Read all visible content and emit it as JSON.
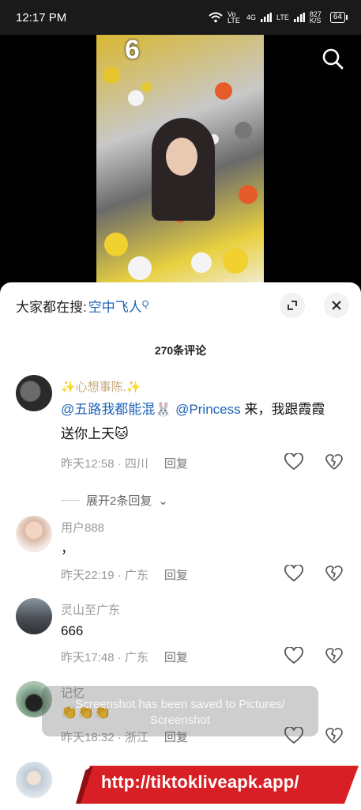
{
  "status": {
    "time": "12:17 PM",
    "net1": "Vo LTE",
    "net2": "4G",
    "net3": "LTE",
    "speed": "827 K/S",
    "battery": "64"
  },
  "video": {
    "number": "6"
  },
  "sheet": {
    "search_prefix": "大家都在搜:",
    "search_term": "空中飞人",
    "count_title": "270条评论"
  },
  "comments": [
    {
      "user": "✨心想事陈.✨",
      "mention1": "@五路我都能混",
      "mention2": "@Princess",
      "text_after": " 来，我跟霞霞送你上天",
      "time": "昨天12:58 · 四川",
      "reply": "回复",
      "expand": "展开2条回复"
    },
    {
      "user": "用户888",
      "text": "，",
      "time": "昨天22:19 · 广东",
      "reply": "回复"
    },
    {
      "user": "灵山至广东",
      "text": "666",
      "time": "昨天17:48 · 广东",
      "reply": "回复"
    },
    {
      "user": "记忆",
      "text": "👏👏👏",
      "time": "昨天18:32 · 浙江",
      "reply": "回复"
    }
  ],
  "toast": {
    "line1": "Screenshot has been saved to  Pictures/",
    "line2": "Screenshot"
  },
  "banner": {
    "url": "http://tiktokliveapk.app/"
  },
  "colors": {
    "accent_link": "#1d63b8",
    "banner_red": "#d81f26"
  }
}
